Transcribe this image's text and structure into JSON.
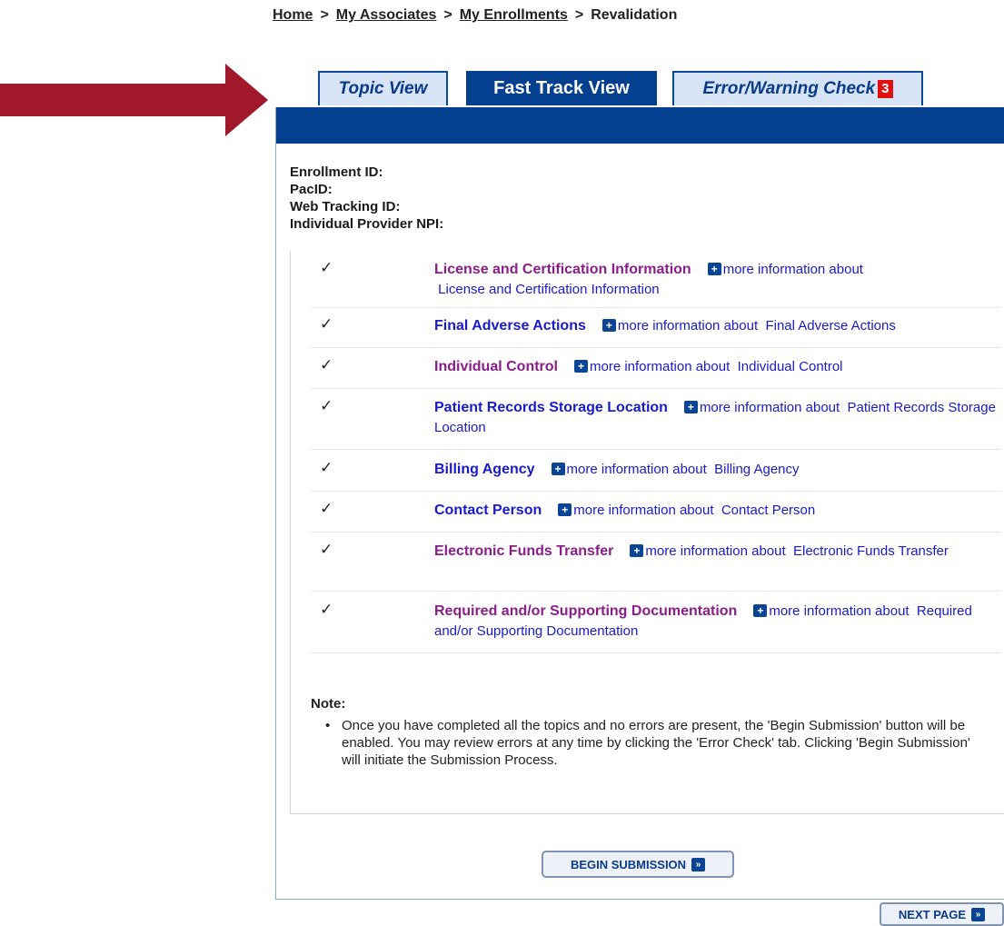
{
  "breadcrumb": {
    "home": "Home",
    "associates": "My Associates",
    "enrollments": "My Enrollments",
    "current": "Revalidation",
    "sep": ">"
  },
  "tabs": {
    "topic_view": "Topic View",
    "fast_track_view": "Fast Track View",
    "error_check": "Error/Warning Check",
    "error_count": "3"
  },
  "info": {
    "enrollment_id": "Enrollment ID:",
    "pac_id": "PacID:",
    "web_tracking_id": "Web Tracking ID:",
    "provider_npi": "Individual Provider NPI:"
  },
  "topics": [
    {
      "name": "License and Certification Information",
      "more": "more information about",
      "more_target": "License and Certification Information",
      "check": "✓"
    },
    {
      "name": "Final Adverse Actions",
      "more": "more information about",
      "more_target": "Final Adverse Actions",
      "check": "✓"
    },
    {
      "name": "Individual Control",
      "more": "more information about",
      "more_target": "Individual Control",
      "check": "✓"
    },
    {
      "name": "Patient Records Storage Location",
      "more": "more information about",
      "more_target": "Patient Records Storage Location",
      "check": "✓"
    },
    {
      "name": "Billing Agency",
      "more": "more information about",
      "more_target": "Billing Agency",
      "check": "✓"
    },
    {
      "name": "Contact Person",
      "more": "more information about",
      "more_target": "Contact Person",
      "check": "✓"
    },
    {
      "name": "Electronic Funds Transfer",
      "more": "more information about",
      "more_target": "Electronic Funds Transfer",
      "check": "✓"
    },
    {
      "name": "Required and/or Supporting Documentation",
      "more": "more information about",
      "more_target": "Required and/or Supporting Documentation",
      "check": "✓"
    }
  ],
  "note": {
    "title": "Note:",
    "text": "Once you have completed all the topics and no errors are present, the 'Begin Submission' button will be enabled. You may review errors at any time by clicking the 'Error Check' tab. Clicking 'Begin Submission' will initiate the Submission Process."
  },
  "buttons": {
    "begin_submission": "BEGIN SUBMISSION",
    "next_page": "NEXT PAGE",
    "arrow_glyph": "»",
    "plus_glyph": "+"
  },
  "colors": {
    "primary_blue": "#053f8f",
    "topic_purple": "#8a1d8a",
    "topic_blue": "#1a1acc",
    "badge_red": "#e01010",
    "arrow_red": "#a0182a"
  }
}
